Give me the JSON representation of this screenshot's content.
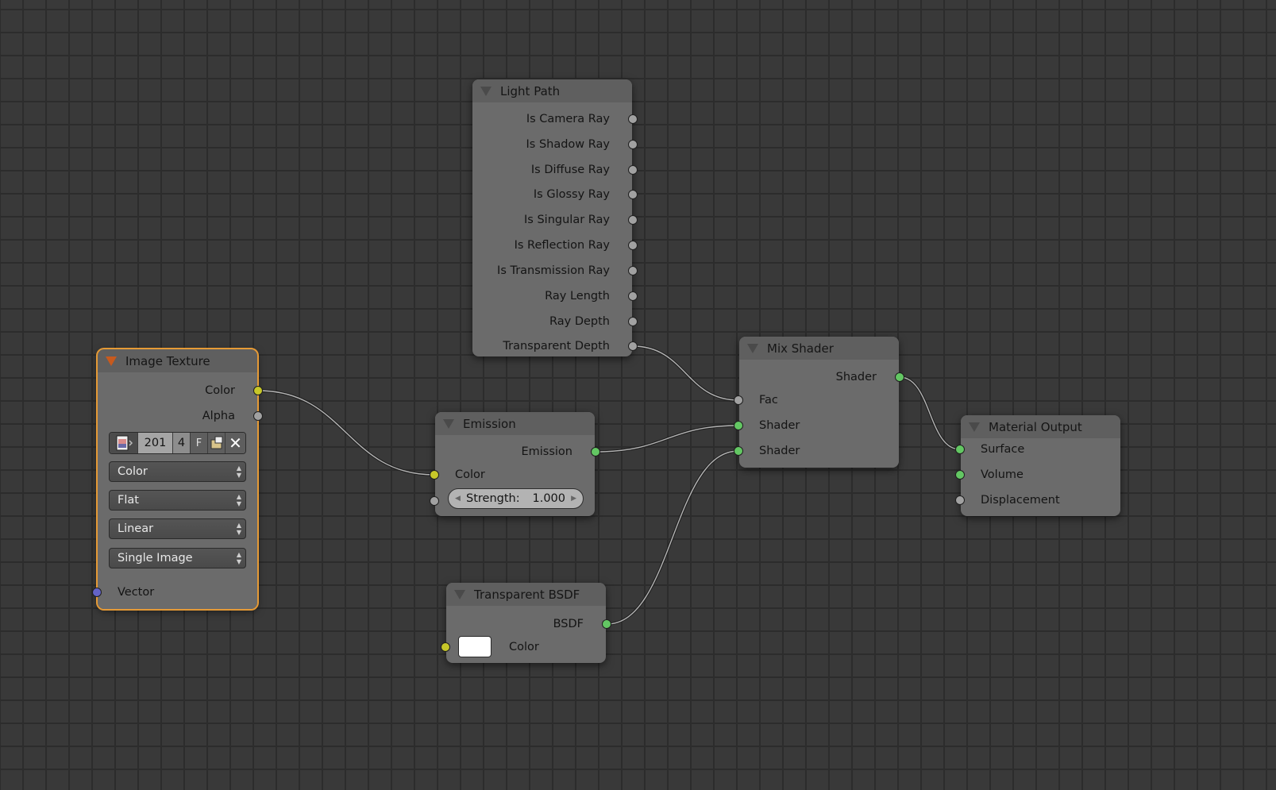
{
  "editor": "Node Editor",
  "nodes": {
    "image_texture": {
      "title": "Image Texture",
      "outputs": [
        "Color",
        "Alpha"
      ],
      "image_block": {
        "name": "201",
        "users": "4",
        "fake_user": "F"
      },
      "dropdowns": [
        {
          "name": "color-space",
          "value": "Color"
        },
        {
          "name": "projection",
          "value": "Flat"
        },
        {
          "name": "interpolation",
          "value": "Linear"
        },
        {
          "name": "source",
          "value": "Single Image"
        }
      ],
      "inputs": [
        "Vector"
      ]
    },
    "light_path": {
      "title": "Light Path",
      "outputs": [
        "Is Camera Ray",
        "Is Shadow Ray",
        "Is Diffuse Ray",
        "Is Glossy Ray",
        "Is Singular Ray",
        "Is Reflection Ray",
        "Is Transmission Ray",
        "Ray Length",
        "Ray Depth",
        "Transparent Depth"
      ]
    },
    "emission": {
      "title": "Emission",
      "outputs": [
        "Emission"
      ],
      "inputs": [
        "Color"
      ],
      "strength": {
        "label": "Strength:",
        "value": "1.000"
      }
    },
    "mix_shader": {
      "title": "Mix Shader",
      "outputs": [
        "Shader"
      ],
      "inputs": [
        "Fac",
        "Shader",
        "Shader"
      ]
    },
    "material_output": {
      "title": "Material Output",
      "inputs": [
        "Surface",
        "Volume",
        "Displacement"
      ]
    },
    "transparent_bsdf": {
      "title": "Transparent BSDF",
      "outputs": [
        "BSDF"
      ],
      "inputs": [
        "Color"
      ],
      "color_value": "#ffffff"
    }
  },
  "socket_colors": {
    "color": "#c7c729",
    "float": "#a1a1a1",
    "shader": "#63c763",
    "vector": "#6363c7"
  },
  "selection_color": "#e59a36",
  "links": [
    {
      "from": "Image Texture.Color",
      "to": "Emission.Color"
    },
    {
      "from": "Light Path.Transparent Depth",
      "to": "Mix Shader.Fac"
    },
    {
      "from": "Emission.Emission",
      "to": "Mix Shader.Shader"
    },
    {
      "from": "Transparent BSDF.BSDF",
      "to": "Mix Shader.Shader"
    },
    {
      "from": "Mix Shader.Shader",
      "to": "Material Output.Surface"
    }
  ]
}
